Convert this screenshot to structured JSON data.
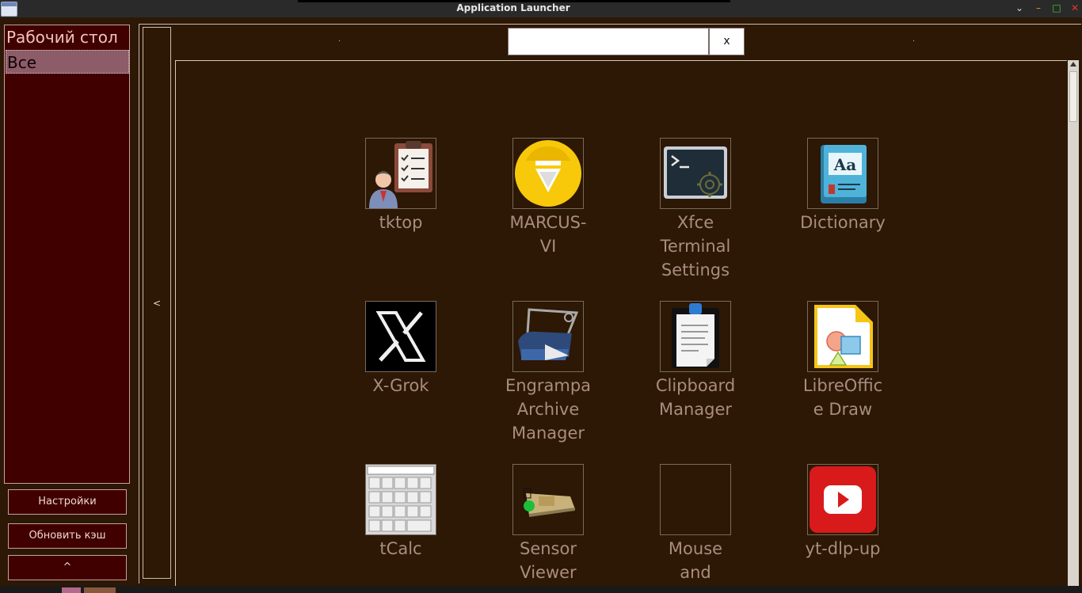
{
  "window": {
    "title": "Application Launcher",
    "controls": {
      "chevron": "⌄",
      "minimize": "–",
      "maximize": "□",
      "close": "✕"
    }
  },
  "sidebar": {
    "categories": [
      {
        "label": "Рабочий стол",
        "selected": false
      },
      {
        "label": "Все",
        "selected": true
      }
    ],
    "buttons": {
      "settings": "Настройки",
      "refresh": "Обновить кэш",
      "up": "^"
    }
  },
  "collapse_label": "<",
  "search": {
    "value": "",
    "clear_label": "x"
  },
  "apps": [
    {
      "name": "tktop",
      "icon": "task-manager-icon"
    },
    {
      "name": "MARCUS-VI",
      "icon": "marcus-vi-icon"
    },
    {
      "name": "Xfce Terminal Settings",
      "icon": "terminal-settings-icon"
    },
    {
      "name": "Dictionary",
      "icon": "dictionary-icon"
    },
    {
      "name": "X-Grok",
      "icon": "x-grok-icon"
    },
    {
      "name": "Engrampa Archive Manager",
      "icon": "archive-manager-icon"
    },
    {
      "name": "Clipboard Manager",
      "icon": "clipboard-icon"
    },
    {
      "name": "LibreOffice Draw",
      "icon": "libreoffice-draw-icon"
    },
    {
      "name": "tCalc",
      "icon": "calculator-icon"
    },
    {
      "name": "Sensor Viewer",
      "icon": "sensor-viewer-icon"
    },
    {
      "name": "Mouse and",
      "icon": "mouse-icon"
    },
    {
      "name": "yt-dlp-up",
      "icon": "youtube-icon"
    }
  ],
  "app_label_lines": [
    [
      "tktop"
    ],
    [
      "MARCUS-",
      "VI"
    ],
    [
      "Xfce",
      "Terminal",
      "Settings"
    ],
    [
      "Dictionary"
    ],
    [
      "X-Grok"
    ],
    [
      "Engrampa",
      "Archive",
      "Manager"
    ],
    [
      "Clipboard",
      "Manager"
    ],
    [
      "LibreOffic",
      "e Draw"
    ],
    [
      "tCalc"
    ],
    [
      "Sensor",
      "Viewer"
    ],
    [
      "Mouse",
      "and"
    ],
    [
      "yt-dlp-up"
    ]
  ],
  "colors": {
    "background": "#2d1705",
    "sidebar_bg": "#400000",
    "selected_category_bg": "#8c5c68",
    "app_label": "#a88d80"
  }
}
